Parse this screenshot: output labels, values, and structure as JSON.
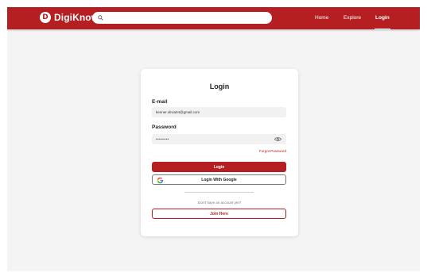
{
  "colors": {
    "brand": "#b51f22",
    "background": "#f4f4f5",
    "card": "#ffffff"
  },
  "navbar": {
    "logo_letter": "D",
    "logo_text": "DigiKnow",
    "search": {
      "placeholder": "",
      "icon": "search-icon"
    },
    "links": {
      "home": "Home",
      "explore": "Explore",
      "login": "Login"
    },
    "active_link": "login"
  },
  "login_card": {
    "title": "Login",
    "email_label": "E-mail",
    "email_value": "kenner.olivia04@gmail.com",
    "password_label": "Password",
    "password_value": "••••••••",
    "password_icon": "eye-icon",
    "forgot_password": "Forgot Password",
    "login_button": "Login",
    "google_button": "Login With Google",
    "google_icon": "google-g-icon",
    "no_account_text": "Don't have an account yet?",
    "join_button": "Join Here"
  }
}
